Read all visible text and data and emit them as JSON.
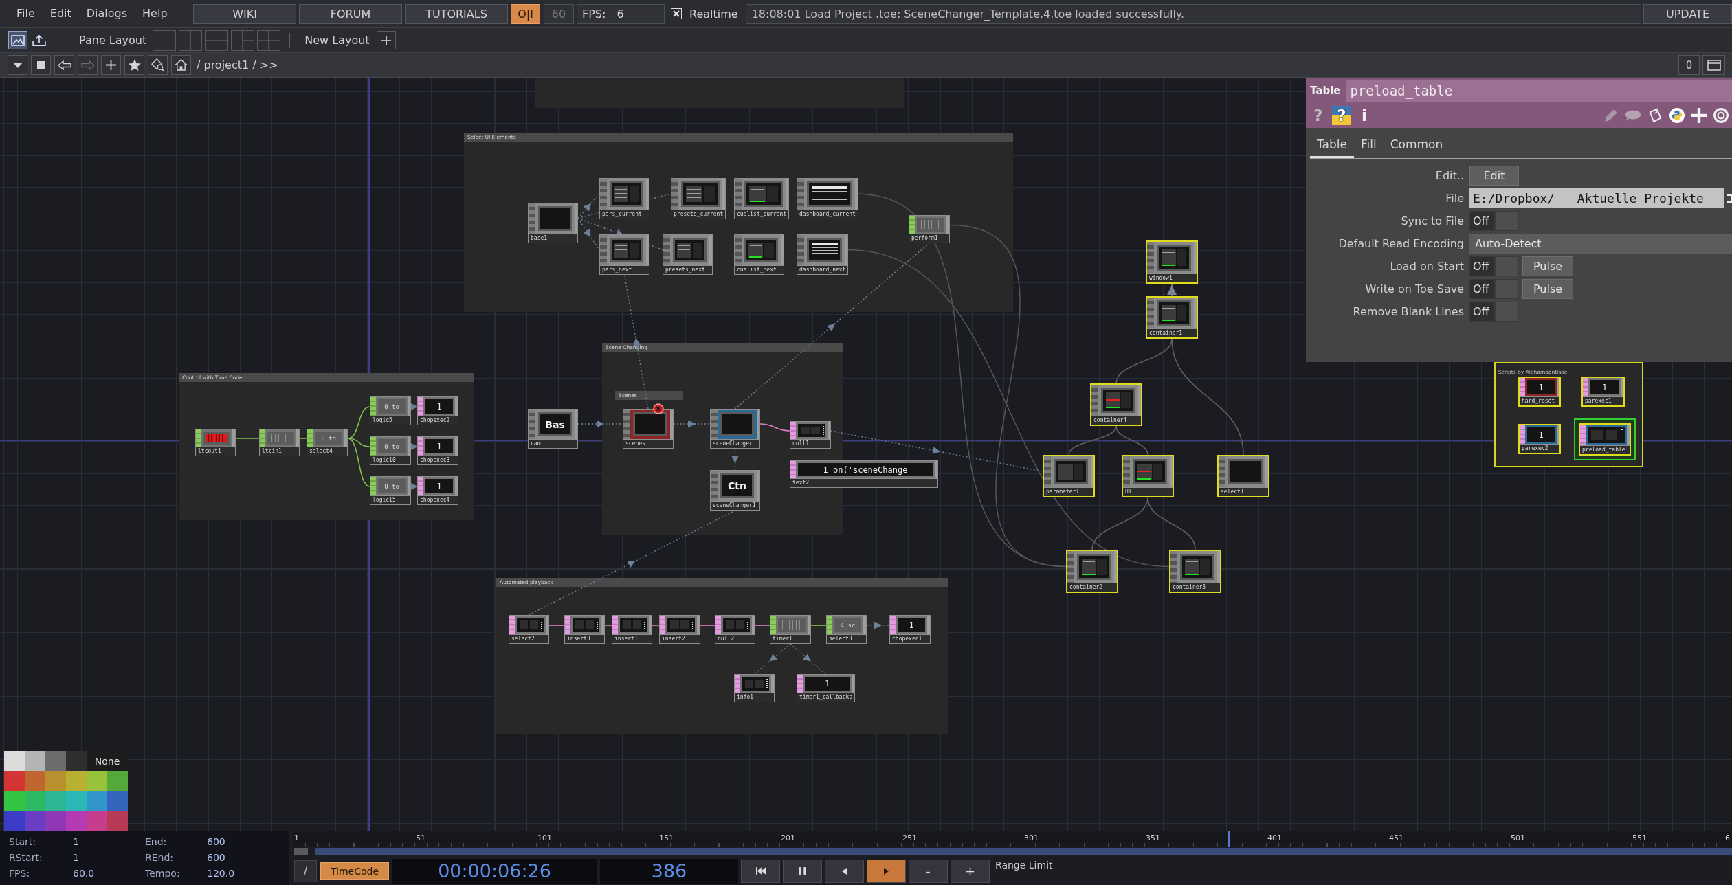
{
  "menu": {
    "items": [
      "File",
      "Edit",
      "Dialogs",
      "Help"
    ],
    "links": [
      "WIKI",
      "FORUM",
      "TUTORIALS"
    ],
    "perform": {
      "label": "O|I",
      "on": true
    },
    "fps_cap": {
      "value": "60",
      "disabled": true
    },
    "fps": {
      "label": "FPS:",
      "value": "6"
    },
    "realtime": {
      "label": "Realtime",
      "checked": true
    },
    "message": "18:08:01 Load Project .toe: SceneChanger_Template.4.toe loaded successfully.",
    "update": "UPDATE"
  },
  "pane_bar": {
    "views": [
      {
        "kind": "network",
        "selected": true
      },
      {
        "kind": "import",
        "selected": false
      }
    ],
    "label": "Pane Layout",
    "layouts": [
      {
        "kind": "single"
      },
      {
        "kind": "columns"
      },
      {
        "kind": "rows"
      },
      {
        "kind": "three"
      },
      {
        "kind": "quad"
      }
    ],
    "new_layout": "New Layout"
  },
  "path_bar": {
    "tools": [
      {
        "kind": "caret",
        "disabled": false
      },
      {
        "kind": "stop",
        "disabled": false
      },
      {
        "kind": "back",
        "disabled": false
      },
      {
        "kind": "forward",
        "disabled": true
      },
      {
        "kind": "add",
        "disabled": false
      },
      {
        "kind": "star",
        "disabled": false
      },
      {
        "kind": "search",
        "disabled": false
      },
      {
        "kind": "home",
        "disabled": false
      }
    ],
    "path": "/ project1 / >>",
    "pane_index": "0"
  },
  "network": {
    "boxes": [
      {
        "kind": "box",
        "selected": false
      },
      {
        "kind": "box",
        "title": "Select UI Elements",
        "selected": false
      },
      {
        "kind": "box",
        "title": "Control with Time Code",
        "selected": false
      },
      {
        "kind": "box",
        "title": "Scene Changing",
        "selected": false
      },
      {
        "kind": "header",
        "title": "Scenes",
        "selected": false
      },
      {
        "kind": "box",
        "title": "Automated playback",
        "selected": false
      },
      {
        "kind": "note",
        "title": "Scripts by AlphamoonBase",
        "selected": true
      }
    ],
    "nodes": [
      {
        "name": "base1",
        "kind": "comp",
        "preview": {
          "kind": "blank"
        },
        "selected": false,
        "current": false,
        "error": false
      },
      {
        "name": "pars_current",
        "kind": "comp",
        "preview": {
          "kind": "ui"
        },
        "selected": false,
        "current": false,
        "error": false
      },
      {
        "name": "presets_current",
        "kind": "comp",
        "preview": {
          "kind": "ui"
        },
        "selected": false,
        "current": false,
        "error": false
      },
      {
        "name": "cuelist_current",
        "kind": "comp",
        "preview": {
          "kind": "ui-green"
        },
        "selected": false,
        "current": false,
        "error": false
      },
      {
        "name": "dashboard_current",
        "kind": "comp",
        "preview": {
          "kind": "dashboard"
        },
        "selected": false,
        "current": false,
        "error": false
      },
      {
        "name": "pars_next",
        "kind": "comp",
        "preview": {
          "kind": "ui"
        },
        "selected": false,
        "current": false,
        "error": false
      },
      {
        "name": "presets_next",
        "kind": "comp",
        "preview": {
          "kind": "ui"
        },
        "selected": false,
        "current": false,
        "error": false
      },
      {
        "name": "cuelist_next",
        "kind": "comp",
        "preview": {
          "kind": "ui-green"
        },
        "selected": false,
        "current": false,
        "error": false
      },
      {
        "name": "dashboard_next",
        "kind": "comp",
        "preview": {
          "kind": "dashboard"
        },
        "selected": false,
        "current": false,
        "error": false
      },
      {
        "name": "perform1",
        "kind": "chop",
        "preview": {
          "kind": "bars"
        },
        "selected": false,
        "current": false,
        "error": false
      },
      {
        "name": "ltcout1",
        "kind": "chop",
        "preview": {
          "kind": "ltc"
        },
        "selected": false,
        "current": false,
        "error": false
      },
      {
        "name": "ltcin1",
        "kind": "chop",
        "preview": {
          "kind": "bars"
        },
        "selected": false,
        "current": false,
        "error": false
      },
      {
        "name": "select4",
        "kind": "chop",
        "preview": {
          "kind": "text",
          "text": "0 to"
        },
        "selected": false,
        "current": false,
        "error": false
      },
      {
        "name": "logic5",
        "kind": "chop",
        "preview": {
          "kind": "text",
          "text": "0 to"
        },
        "selected": false,
        "current": false,
        "error": false
      },
      {
        "name": "chopexec2",
        "kind": "dat",
        "preview": {
          "kind": "text",
          "text": "1"
        },
        "selected": false,
        "current": false,
        "error": false
      },
      {
        "name": "logic10",
        "kind": "chop",
        "preview": {
          "kind": "text",
          "text": "0 to"
        },
        "selected": false,
        "current": false,
        "error": false
      },
      {
        "name": "chopexec3",
        "kind": "dat",
        "preview": {
          "kind": "text",
          "text": "1"
        },
        "selected": false,
        "current": false,
        "error": false
      },
      {
        "name": "logic15",
        "kind": "chop",
        "preview": {
          "kind": "text",
          "text": "0 to"
        },
        "selected": false,
        "current": false,
        "error": false
      },
      {
        "name": "chopexec4",
        "kind": "dat",
        "preview": {
          "kind": "text",
          "text": "1"
        },
        "selected": false,
        "current": false,
        "error": false
      },
      {
        "name": "cam",
        "kind": "comp",
        "preview": {
          "kind": "text",
          "text": "Bas"
        },
        "selected": false,
        "current": false,
        "error": false
      },
      {
        "name": "scenes",
        "kind": "comp",
        "preview": {
          "kind": "blank"
        },
        "color": "#8c2626",
        "selected": false,
        "current": false,
        "error": true
      },
      {
        "name": "sceneChanger",
        "kind": "comp",
        "preview": {
          "kind": "blank"
        },
        "color": "#2a6a96",
        "selected": false,
        "current": false,
        "error": false
      },
      {
        "name": "null1",
        "kind": "dat",
        "preview": {
          "kind": "table"
        },
        "selected": false,
        "current": false,
        "error": false
      },
      {
        "name": "text2",
        "kind": "dat",
        "preview": {
          "kind": "text",
          "text": "1 on('sceneChange"
        },
        "selected": false,
        "current": false,
        "error": false
      },
      {
        "name": "sceneChanger1",
        "kind": "comp",
        "preview": {
          "kind": "text",
          "text": "Ctn"
        },
        "selected": false,
        "current": false,
        "error": false
      },
      {
        "name": "select2",
        "kind": "dat",
        "preview": {
          "kind": "table"
        },
        "selected": false,
        "current": false,
        "error": false
      },
      {
        "name": "insert3",
        "kind": "dat",
        "preview": {
          "kind": "table"
        },
        "selected": false,
        "current": false,
        "error": false
      },
      {
        "name": "insert1",
        "kind": "dat",
        "preview": {
          "kind": "table"
        },
        "selected": false,
        "current": false,
        "error": false
      },
      {
        "name": "insert2",
        "kind": "dat",
        "preview": {
          "kind": "table"
        },
        "selected": false,
        "current": false,
        "error": false
      },
      {
        "name": "null2",
        "kind": "dat",
        "preview": {
          "kind": "table"
        },
        "selected": false,
        "current": false,
        "error": false
      },
      {
        "name": "timer1",
        "kind": "chop",
        "preview": {
          "kind": "bars"
        },
        "selected": false,
        "current": false,
        "error": false
      },
      {
        "name": "select3",
        "kind": "chop",
        "preview": {
          "kind": "text",
          "text": "4 sc"
        },
        "selected": false,
        "current": false,
        "error": false
      },
      {
        "name": "chopexec1",
        "kind": "dat",
        "preview": {
          "kind": "text",
          "text": "1"
        },
        "selected": false,
        "current": false,
        "error": false
      },
      {
        "name": "info1",
        "kind": "dat",
        "preview": {
          "kind": "table"
        },
        "selected": false,
        "current": false,
        "error": false
      },
      {
        "name": "timer1_callbacks",
        "kind": "dat",
        "preview": {
          "kind": "text",
          "text": "1"
        },
        "selected": false,
        "current": false,
        "error": false
      },
      {
        "name": "window1",
        "kind": "comp",
        "preview": {
          "kind": "ui-green"
        },
        "selected": true,
        "current": false,
        "error": false
      },
      {
        "name": "container1",
        "kind": "comp",
        "preview": {
          "kind": "ui-green"
        },
        "selected": true,
        "current": false,
        "error": false
      },
      {
        "name": "container4",
        "kind": "comp",
        "preview": {
          "kind": "ui-red"
        },
        "selected": true,
        "current": false,
        "error": false
      },
      {
        "name": "parameter1",
        "kind": "comp",
        "preview": {
          "kind": "ui"
        },
        "selected": true,
        "current": false,
        "error": false
      },
      {
        "name": "UI",
        "kind": "comp",
        "preview": {
          "kind": "ui-red"
        },
        "selected": true,
        "current": false,
        "error": false
      },
      {
        "name": "select1",
        "kind": "comp",
        "preview": {
          "kind": "blank"
        },
        "selected": true,
        "current": false,
        "error": false
      },
      {
        "name": "container2",
        "kind": "comp",
        "preview": {
          "kind": "ui-green"
        },
        "selected": true,
        "current": false,
        "error": false
      },
      {
        "name": "container3",
        "kind": "comp",
        "preview": {
          "kind": "ui-green"
        },
        "selected": true,
        "current": false,
        "error": false
      },
      {
        "name": "hard_reset",
        "kind": "dat",
        "preview": {
          "kind": "text",
          "text": "1"
        },
        "color": "#8c2626",
        "selected": true,
        "current": false,
        "error": false
      },
      {
        "name": "parexec1",
        "kind": "dat",
        "preview": {
          "kind": "text",
          "text": "1"
        },
        "selected": true,
        "current": false,
        "error": false
      },
      {
        "name": "parexec2",
        "kind": "dat",
        "preview": {
          "kind": "text",
          "text": "1"
        },
        "color": "#2a6a96",
        "selected": true,
        "current": false,
        "error": false
      },
      {
        "name": "preload_table",
        "kind": "dat",
        "preview": {
          "kind": "table"
        },
        "color": "#2a6a96",
        "selected": true,
        "current": true,
        "error": false
      }
    ]
  },
  "parameters": {
    "type": "Table",
    "name": "preload_table",
    "tools_left": [
      {
        "kind": "help",
        "text": "?"
      },
      {
        "kind": "python-help",
        "text": "?"
      },
      {
        "kind": "info",
        "text": "i"
      }
    ],
    "tools_right": [
      {
        "kind": "pencil"
      },
      {
        "kind": "comment"
      },
      {
        "kind": "clipboard"
      },
      {
        "kind": "python"
      },
      {
        "kind": "plus"
      },
      {
        "kind": "ring"
      }
    ],
    "tabs": [
      {
        "label": "Table",
        "selected": true
      },
      {
        "label": "Fill",
        "selected": false
      },
      {
        "label": "Common",
        "selected": false
      }
    ],
    "rows": [
      {
        "label": "Edit..",
        "kind": "button",
        "button": "Edit"
      },
      {
        "label": "File",
        "kind": "file",
        "value": "E:/Dropbox/___Aktuelle_Projekte"
      },
      {
        "label": "Sync to File",
        "kind": "toggle",
        "value": "Off",
        "on": false
      },
      {
        "label": "Default Read Encoding",
        "kind": "menu",
        "value": "Auto-Detect"
      },
      {
        "label": "Load on Start",
        "kind": "toggle",
        "value": "Off",
        "on": false,
        "pulse": "Pulse"
      },
      {
        "label": "Write on Toe Save",
        "kind": "toggle",
        "value": "Off",
        "on": false,
        "pulse": "Pulse"
      },
      {
        "label": "Remove Blank Lines",
        "kind": "toggle",
        "value": "Off",
        "on": false
      }
    ]
  },
  "palette": {
    "rows": [
      {
        "swatches": [
          {
            "color": "#dcdcdc"
          },
          {
            "color": "#b4b4b4"
          },
          {
            "color": "#6c6c6c"
          },
          {
            "color": "#2e2e2e"
          }
        ],
        "none_label": "None"
      },
      {
        "swatches": [
          {
            "color": "#d33434"
          },
          {
            "color": "#c0652d"
          },
          {
            "color": "#b9902e"
          },
          {
            "color": "#b7b032"
          },
          {
            "color": "#97c23a"
          },
          {
            "color": "#55a83a"
          }
        ]
      },
      {
        "swatches": [
          {
            "color": "#33c541"
          },
          {
            "color": "#2db864"
          },
          {
            "color": "#2db594"
          },
          {
            "color": "#2bb7b7"
          },
          {
            "color": "#3196c9"
          },
          {
            "color": "#3566bd"
          }
        ]
      },
      {
        "swatches": [
          {
            "color": "#3c3cc6"
          },
          {
            "color": "#6a3ec4"
          },
          {
            "color": "#8e38b8"
          },
          {
            "color": "#b53bb5"
          },
          {
            "color": "#c73d8e"
          },
          {
            "color": "#b73a57"
          }
        ]
      }
    ]
  },
  "timeline": {
    "range": [
      {
        "label": "Start:",
        "value": "1"
      },
      {
        "label": "End:",
        "value": "600"
      },
      {
        "label": "RStart:",
        "value": "1"
      },
      {
        "label": "REnd:",
        "value": "600"
      },
      {
        "label": "FPS:",
        "value": "60.0"
      },
      {
        "label": "Tempo:",
        "value": "120.0"
      }
    ],
    "ruler": [
      "1",
      "51",
      "101",
      "151",
      "201",
      "251",
      "301",
      "351",
      "401",
      "451",
      "501",
      "551",
      "6"
    ],
    "playhead": {
      "level": 0.65
    },
    "view_toggle": "/",
    "timecode_button": {
      "label": "TimeCode",
      "on": true
    },
    "timecode": "00:00:06:26",
    "frame": "386",
    "transport": [
      {
        "kind": "to-start",
        "selected": false
      },
      {
        "kind": "pause",
        "selected": false
      },
      {
        "kind": "step-back",
        "selected": false
      },
      {
        "kind": "play",
        "selected": true
      },
      {
        "kind": "label",
        "label": "-",
        "selected": false
      },
      {
        "kind": "label",
        "label": "+",
        "selected": false
      }
    ],
    "range_limit": "Range Limit"
  }
}
